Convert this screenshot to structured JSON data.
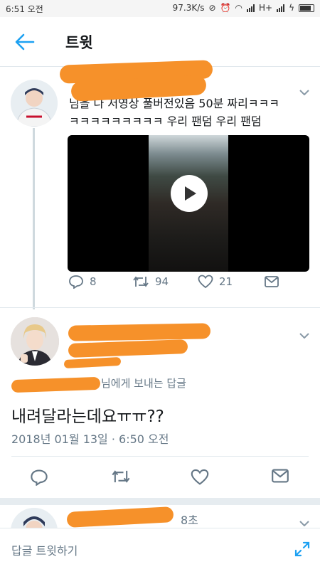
{
  "status_bar": {
    "time": "6:51 오전",
    "network_speed": "97.3K/s",
    "network_type": "H+"
  },
  "header": {
    "title": "트윗"
  },
  "tweet1": {
    "text_line1": "님을 나 저영상 풀버전있음 50분 짜리ㅋㅋㅋ",
    "text_line2": "ㅋㅋㅋㅋㅋㅋㅋㅋㅋ 우리 팬덤 우리 팬덤",
    "replies": "8",
    "retweets": "94",
    "likes": "21"
  },
  "tweet2": {
    "reply_to_suffix": "님에게 보내는 답글",
    "text": "내려달라는데요ㅠㅠ??",
    "date": "2018년 01월 13일 · 6:50 오전"
  },
  "tweet3": {
    "time": "8초"
  },
  "compose": {
    "placeholder": "답글 트윗하기"
  },
  "colors": {
    "accent": "#1da1f2",
    "secondary_text": "#657786",
    "redaction": "#f6912a"
  }
}
